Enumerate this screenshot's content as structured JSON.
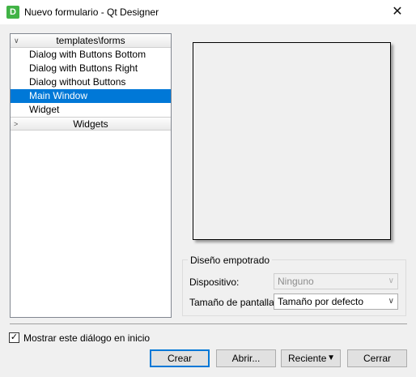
{
  "window": {
    "app_icon_letter": "D",
    "title": "Nuevo formulario - Qt Designer",
    "close_glyph": "✕"
  },
  "tree": {
    "templates_header": "templates\\forms",
    "templates_items": [
      "Dialog with Buttons Bottom",
      "Dialog with Buttons Right",
      "Dialog without Buttons",
      "Main Window",
      "Widget"
    ],
    "selected_item": "Main Window",
    "widgets_header": "Widgets"
  },
  "embedded_design": {
    "group_title": "Diseño empotrado",
    "device_label": "Dispositivo:",
    "device_value": "Ninguno",
    "screen_size_label": "Tamaño de pantalla:",
    "screen_size_value": "Tamaño por defecto"
  },
  "show_on_startup": {
    "label": "Mostrar este diálogo en inicio",
    "checked": true
  },
  "buttons": {
    "create": "Crear",
    "open": "Abrir...",
    "recent": "Reciente",
    "close": "Cerrar"
  },
  "colors": {
    "selection": "#0078d7",
    "app_icon": "#41b346"
  }
}
